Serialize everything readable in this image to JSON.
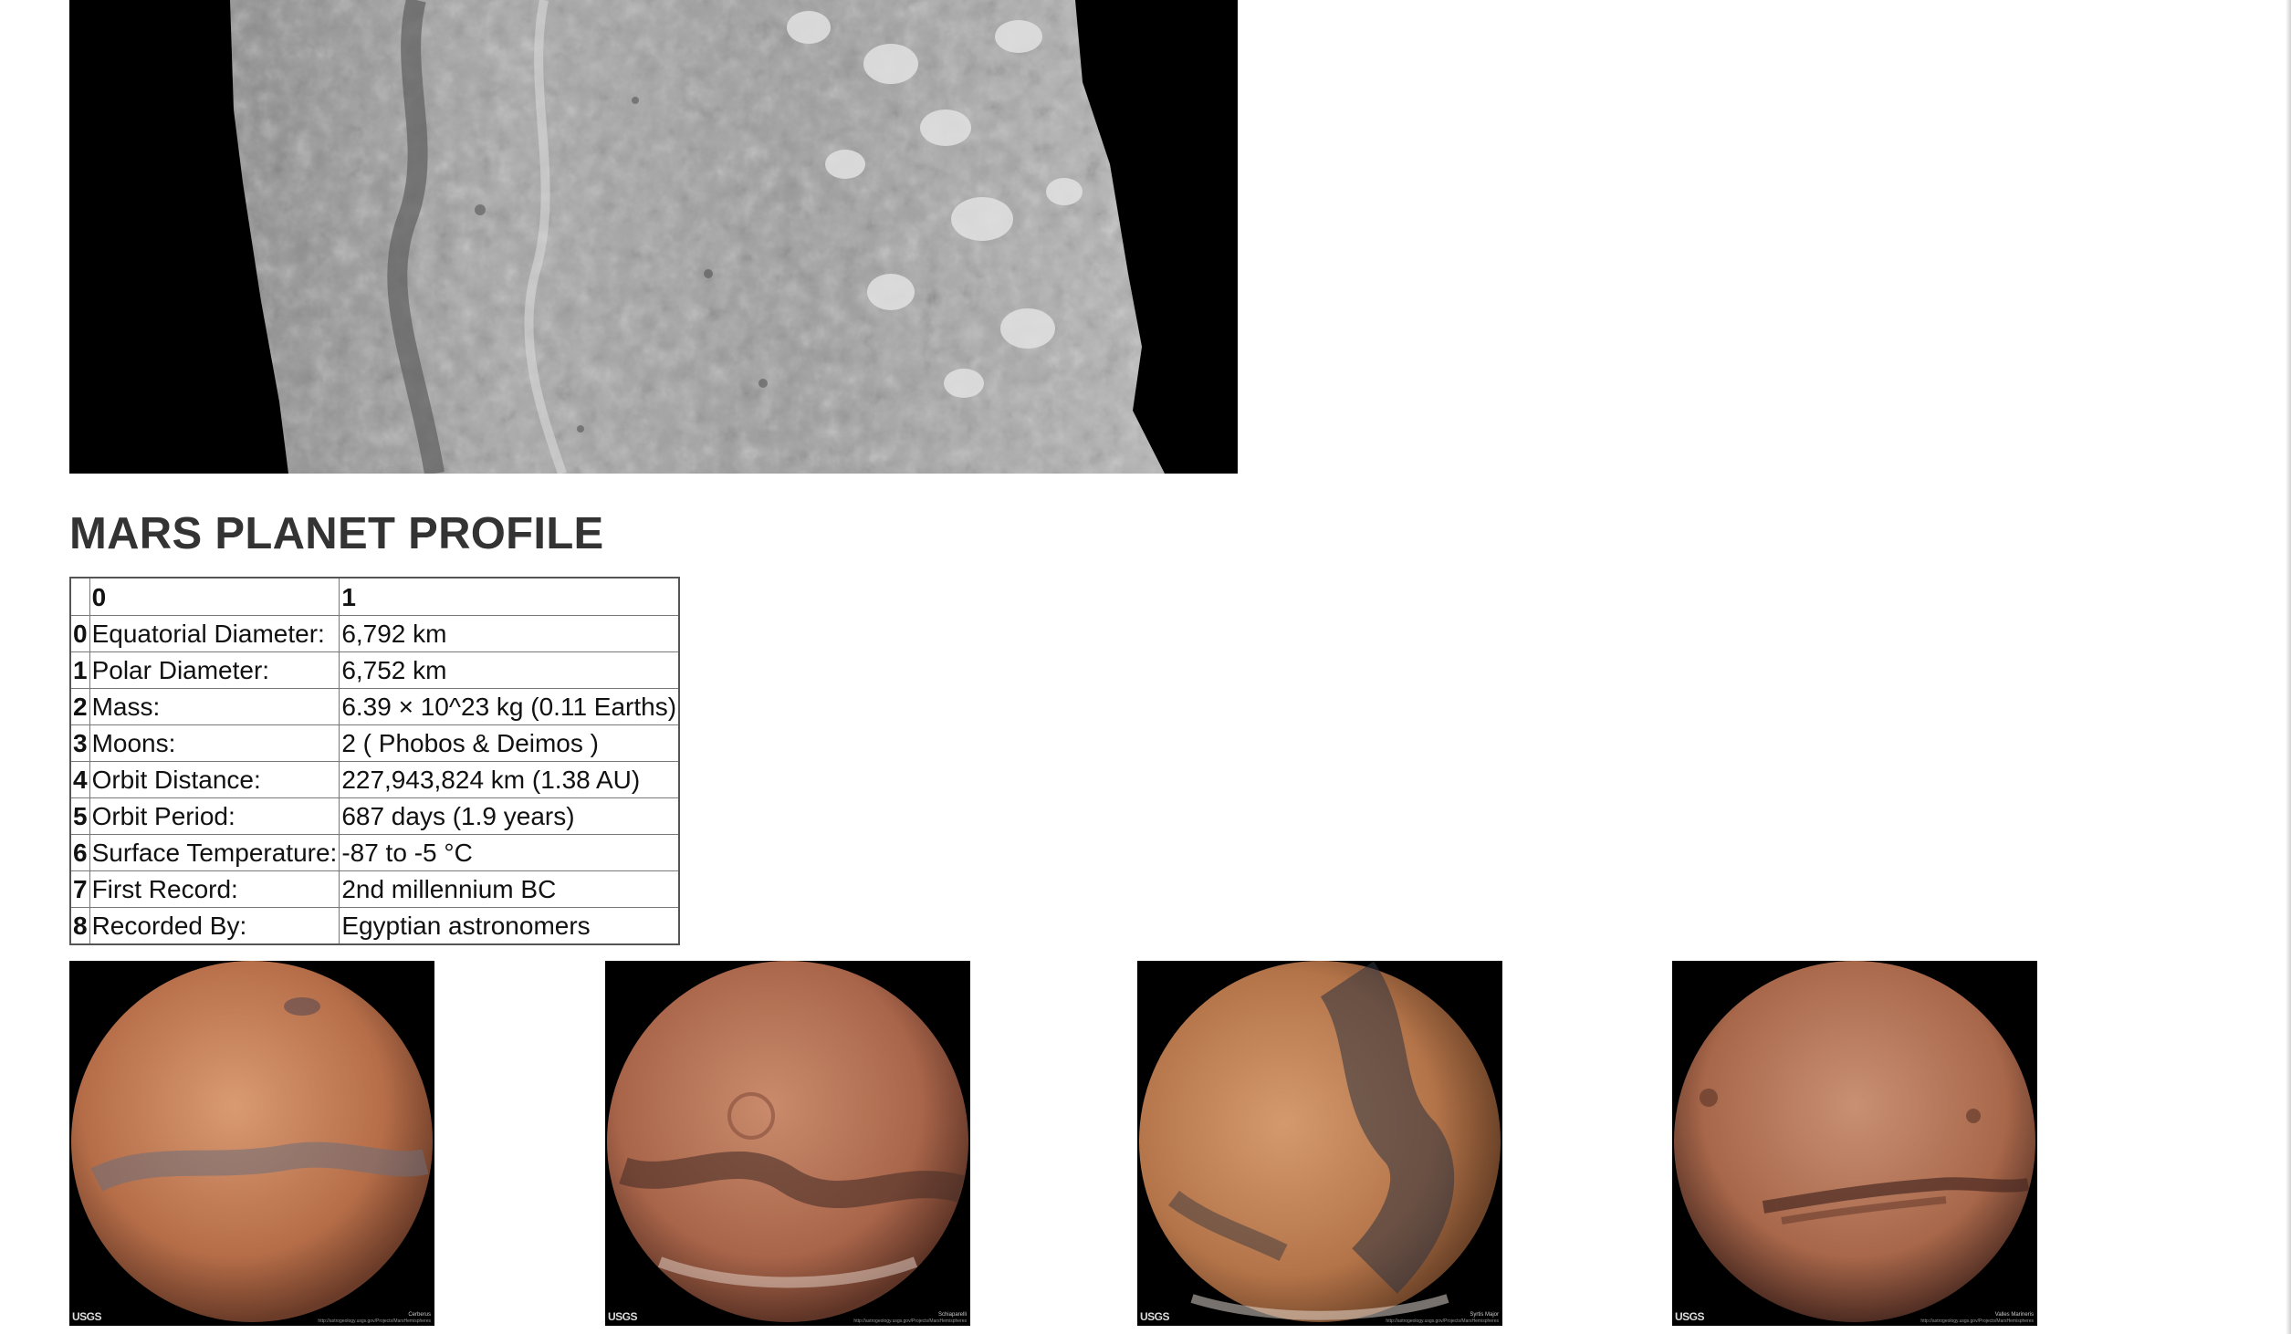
{
  "featured_image": {
    "alt": "Mars surface grayscale image"
  },
  "profile": {
    "title": "MARS PLANET PROFILE",
    "table": {
      "corner": "",
      "columns": [
        "0",
        "1"
      ],
      "rows": [
        {
          "index": "0",
          "label": "Equatorial Diameter:",
          "value": "6,792 km"
        },
        {
          "index": "1",
          "label": "Polar Diameter:",
          "value": "6,752 km"
        },
        {
          "index": "2",
          "label": "Mass:",
          "value": "6.39 × 10^23 kg (0.11 Earths)"
        },
        {
          "index": "3",
          "label": "Moons:",
          "value": "2 ( Phobos & Deimos )"
        },
        {
          "index": "4",
          "label": "Orbit Distance:",
          "value": "227,943,824 km (1.38 AU)"
        },
        {
          "index": "5",
          "label": "Orbit Period:",
          "value": "687 days (1.9 years)"
        },
        {
          "index": "6",
          "label": "Surface Temperature:",
          "value": "-87 to -5 °C"
        },
        {
          "index": "7",
          "label": "First Record:",
          "value": "2nd millennium BC"
        },
        {
          "index": "8",
          "label": "Recorded By:",
          "value": "Egyptian astronomers"
        }
      ]
    }
  },
  "hemispheres": [
    {
      "logo": "USGS",
      "name": "Cerberus",
      "url": "http://astrogeology.usgs.gov/Projects/MarsHemispheres"
    },
    {
      "logo": "USGS",
      "name": "Schiaparelli",
      "url": "http://astrogeology.usgs.gov/Projects/MarsHemispheres"
    },
    {
      "logo": "USGS",
      "name": "Syrtis Major",
      "url": "http://astrogeology.usgs.gov/Projects/MarsHemispheres"
    },
    {
      "logo": "USGS",
      "name": "Valles Marineris",
      "url": "http://astrogeology.usgs.gov/Projects/MarsHemispheres"
    }
  ],
  "colors": {
    "mars_orange": "#c4714a",
    "mars_dark": "#5a3b2f",
    "background": "#ffffff"
  }
}
